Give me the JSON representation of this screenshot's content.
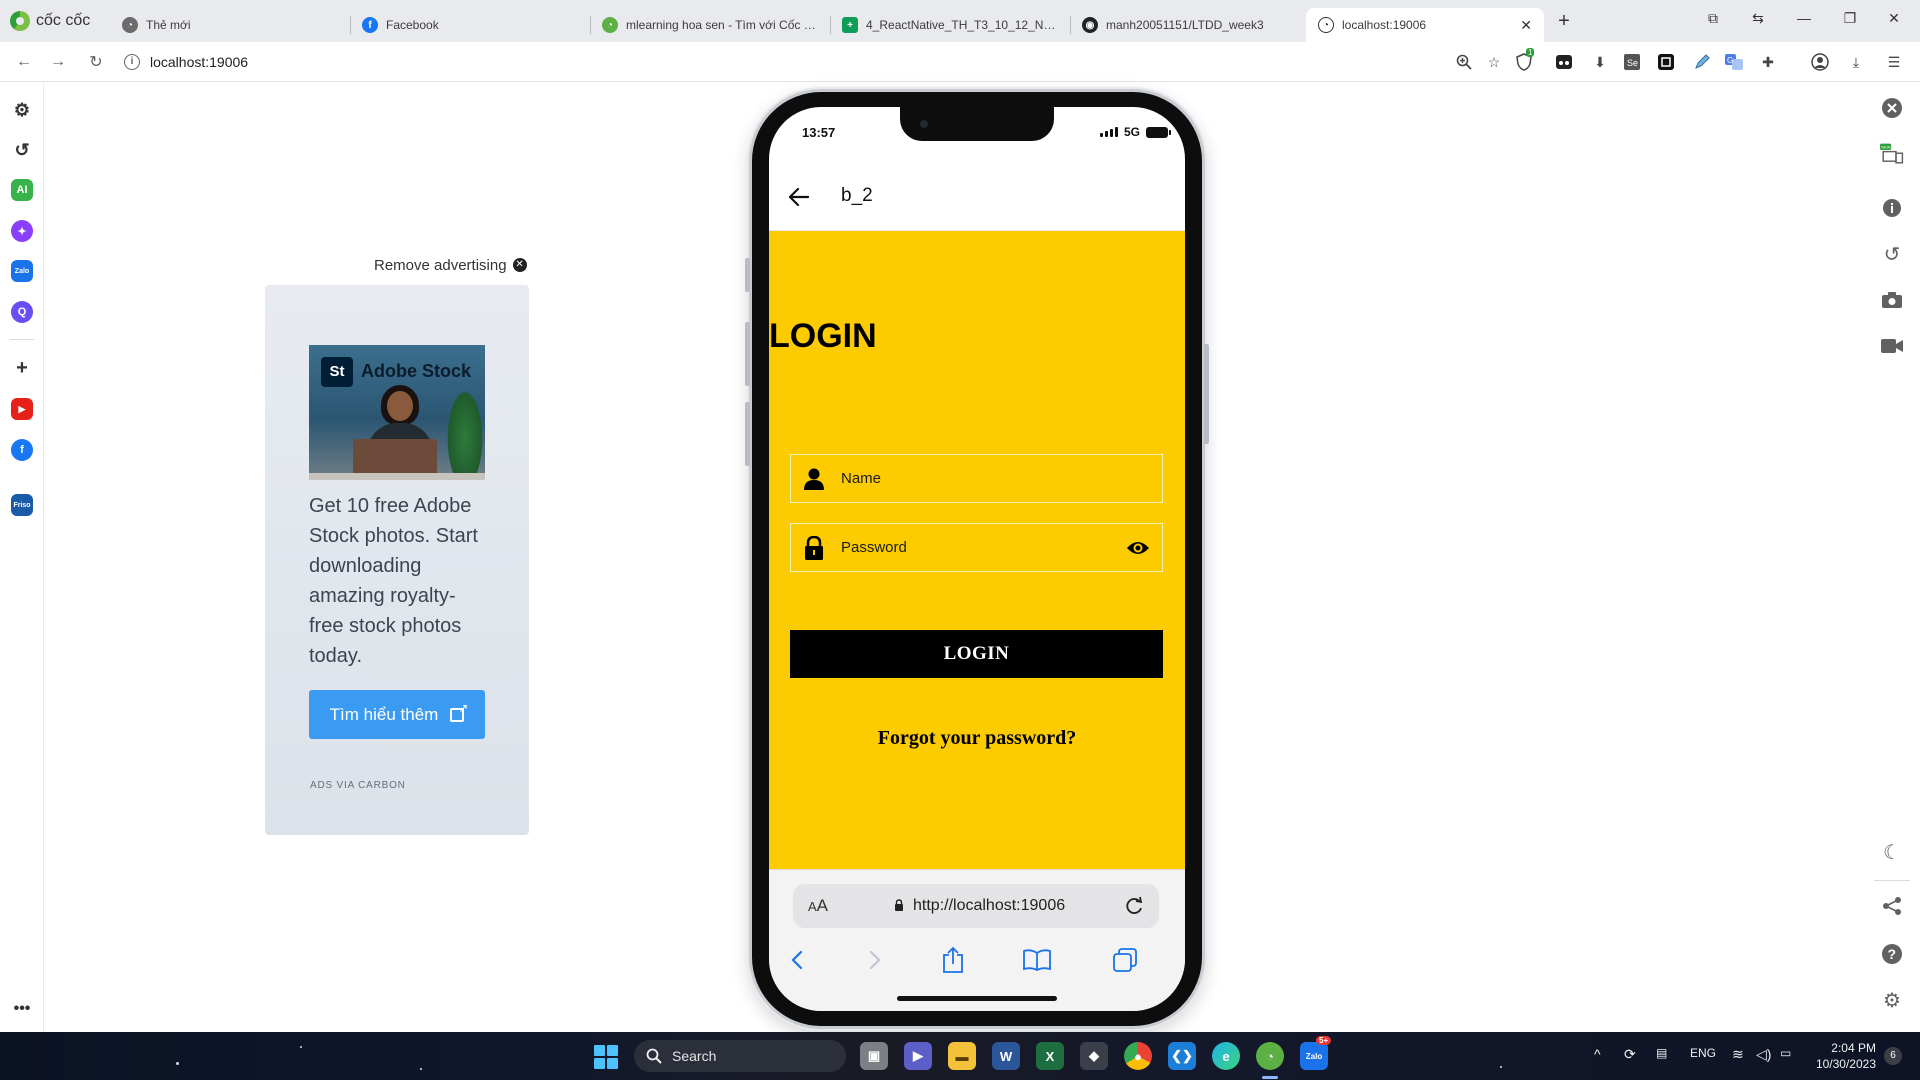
{
  "browser": {
    "brand": "cốc cốc",
    "tabs": [
      {
        "label": "Thẻ mới",
        "icon": "coccoc-icon"
      },
      {
        "label": "Facebook",
        "icon": "facebook-icon"
      },
      {
        "label": "mlearning hoa sen - Tìm với Cốc Cốc",
        "icon": "coccoc-icon"
      },
      {
        "label": "4_ReactNative_TH_T3_10_12_N2 - Go",
        "icon": "google-sheets-icon"
      },
      {
        "label": "manh20051151/LTDD_week3",
        "icon": "github-icon"
      },
      {
        "label": "localhost:19006",
        "icon": "expo-icon",
        "active": true
      }
    ],
    "address": "localhost:19006",
    "extension_badge": "1"
  },
  "ad": {
    "remove_label": "Remove advertising",
    "image_brand_mark": "St",
    "image_brand_text": "Adobe Stock",
    "text": "Get 10 free Adobe Stock photos. Start downloading amazing royalty-free stock photos today.",
    "cta": "Tìm hiểu thêm",
    "via": "ADS VIA CARBON"
  },
  "phone": {
    "status_time": "13:57",
    "network": "5G",
    "header_title": "b_2",
    "login_heading": "LOGIN",
    "name_placeholder": "Name",
    "password_placeholder": "Password",
    "login_button": "LOGIN",
    "forgot_link": "Forgot your password?",
    "safari_aa_big": "A",
    "safari_aa_small": "A",
    "safari_url": "http://localhost:19006",
    "body_color": "#fccb00"
  },
  "taskbar": {
    "search_label": "Search",
    "language": "ENG",
    "time": "2:04 PM",
    "date": "10/30/2023",
    "zalo_badge": "5+",
    "notifications": "6"
  }
}
